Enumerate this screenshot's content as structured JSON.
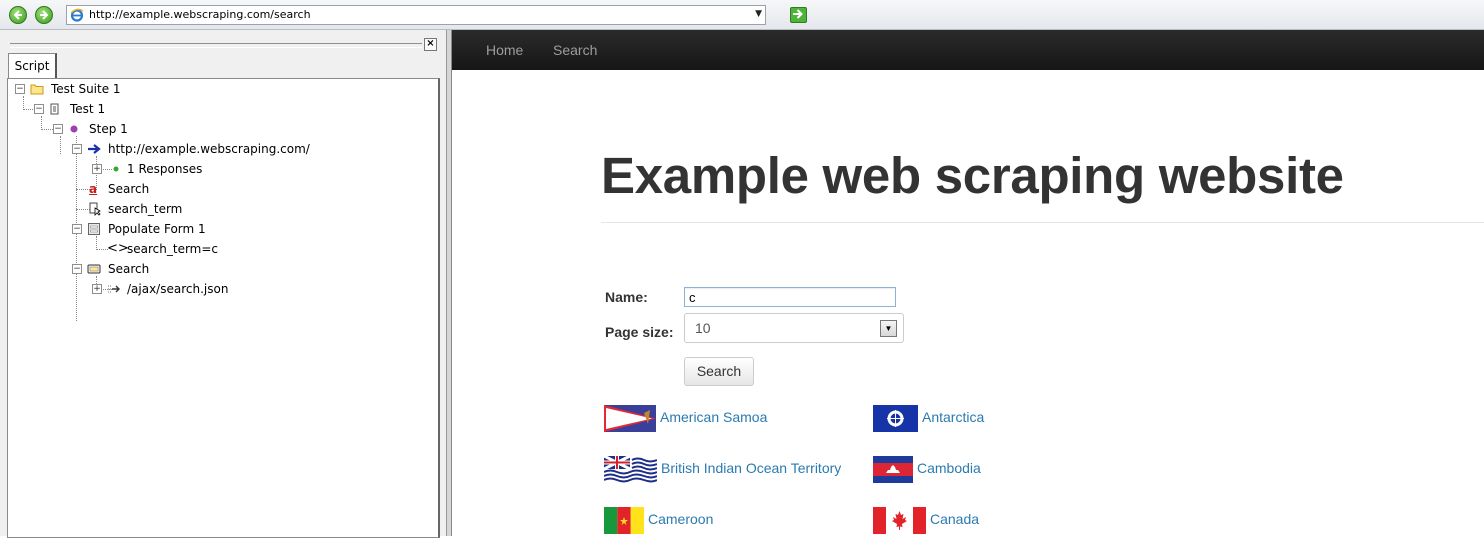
{
  "address_bar": {
    "url": "http://example.webscraping.com/search",
    "icons": [
      "back-icon",
      "forward-icon",
      "ie-page-icon",
      "dropdown-arrow-icon",
      "go-icon"
    ]
  },
  "left_panel": {
    "tab_label": "Script",
    "close_glyph": "×",
    "tree": [
      {
        "label": "Test Suite 1",
        "icon": "folder-icon"
      },
      {
        "label": "Test 1",
        "icon": "test-icon"
      },
      {
        "label": "Step 1",
        "icon": "step-icon"
      },
      {
        "label": "http://example.webscraping.com/",
        "icon": "navigate-arrow-icon"
      },
      {
        "label": "1 Responses",
        "icon": "green-dot-icon"
      },
      {
        "label": "Search",
        "icon": "text-a-icon"
      },
      {
        "label": "search_term",
        "icon": "cursor-icon"
      },
      {
        "label": "Populate Form 1",
        "icon": "form-icon"
      },
      {
        "label": "search_term=c",
        "icon": "code-brackets-icon"
      },
      {
        "label": "Search",
        "icon": "button-icon"
      },
      {
        "label": "/ajax/search.json",
        "icon": "ajax-request-icon"
      }
    ]
  },
  "site": {
    "nav": [
      "Home",
      "Search"
    ],
    "heading": "Example web scraping website",
    "form": {
      "name_label": "Name:",
      "name_value": "c",
      "page_size_label": "Page size:",
      "page_size_value": "10",
      "search_button": "Search"
    },
    "countries": [
      {
        "name": "American Samoa",
        "flag": "american-samoa-flag-icon"
      },
      {
        "name": "Antarctica",
        "flag": "antarctica-flag-icon"
      },
      {
        "name": "British Indian Ocean Territory",
        "flag": "british-indian-ocean-territory-flag-icon"
      },
      {
        "name": "Cambodia",
        "flag": "cambodia-flag-icon"
      },
      {
        "name": "Cameroon",
        "flag": "cameroon-flag-icon"
      },
      {
        "name": "Canada",
        "flag": "canada-flag-icon"
      }
    ],
    "colors": {
      "navbar": "#1b1b1b",
      "link": "#2a7ab0",
      "heading": "#333333"
    }
  }
}
